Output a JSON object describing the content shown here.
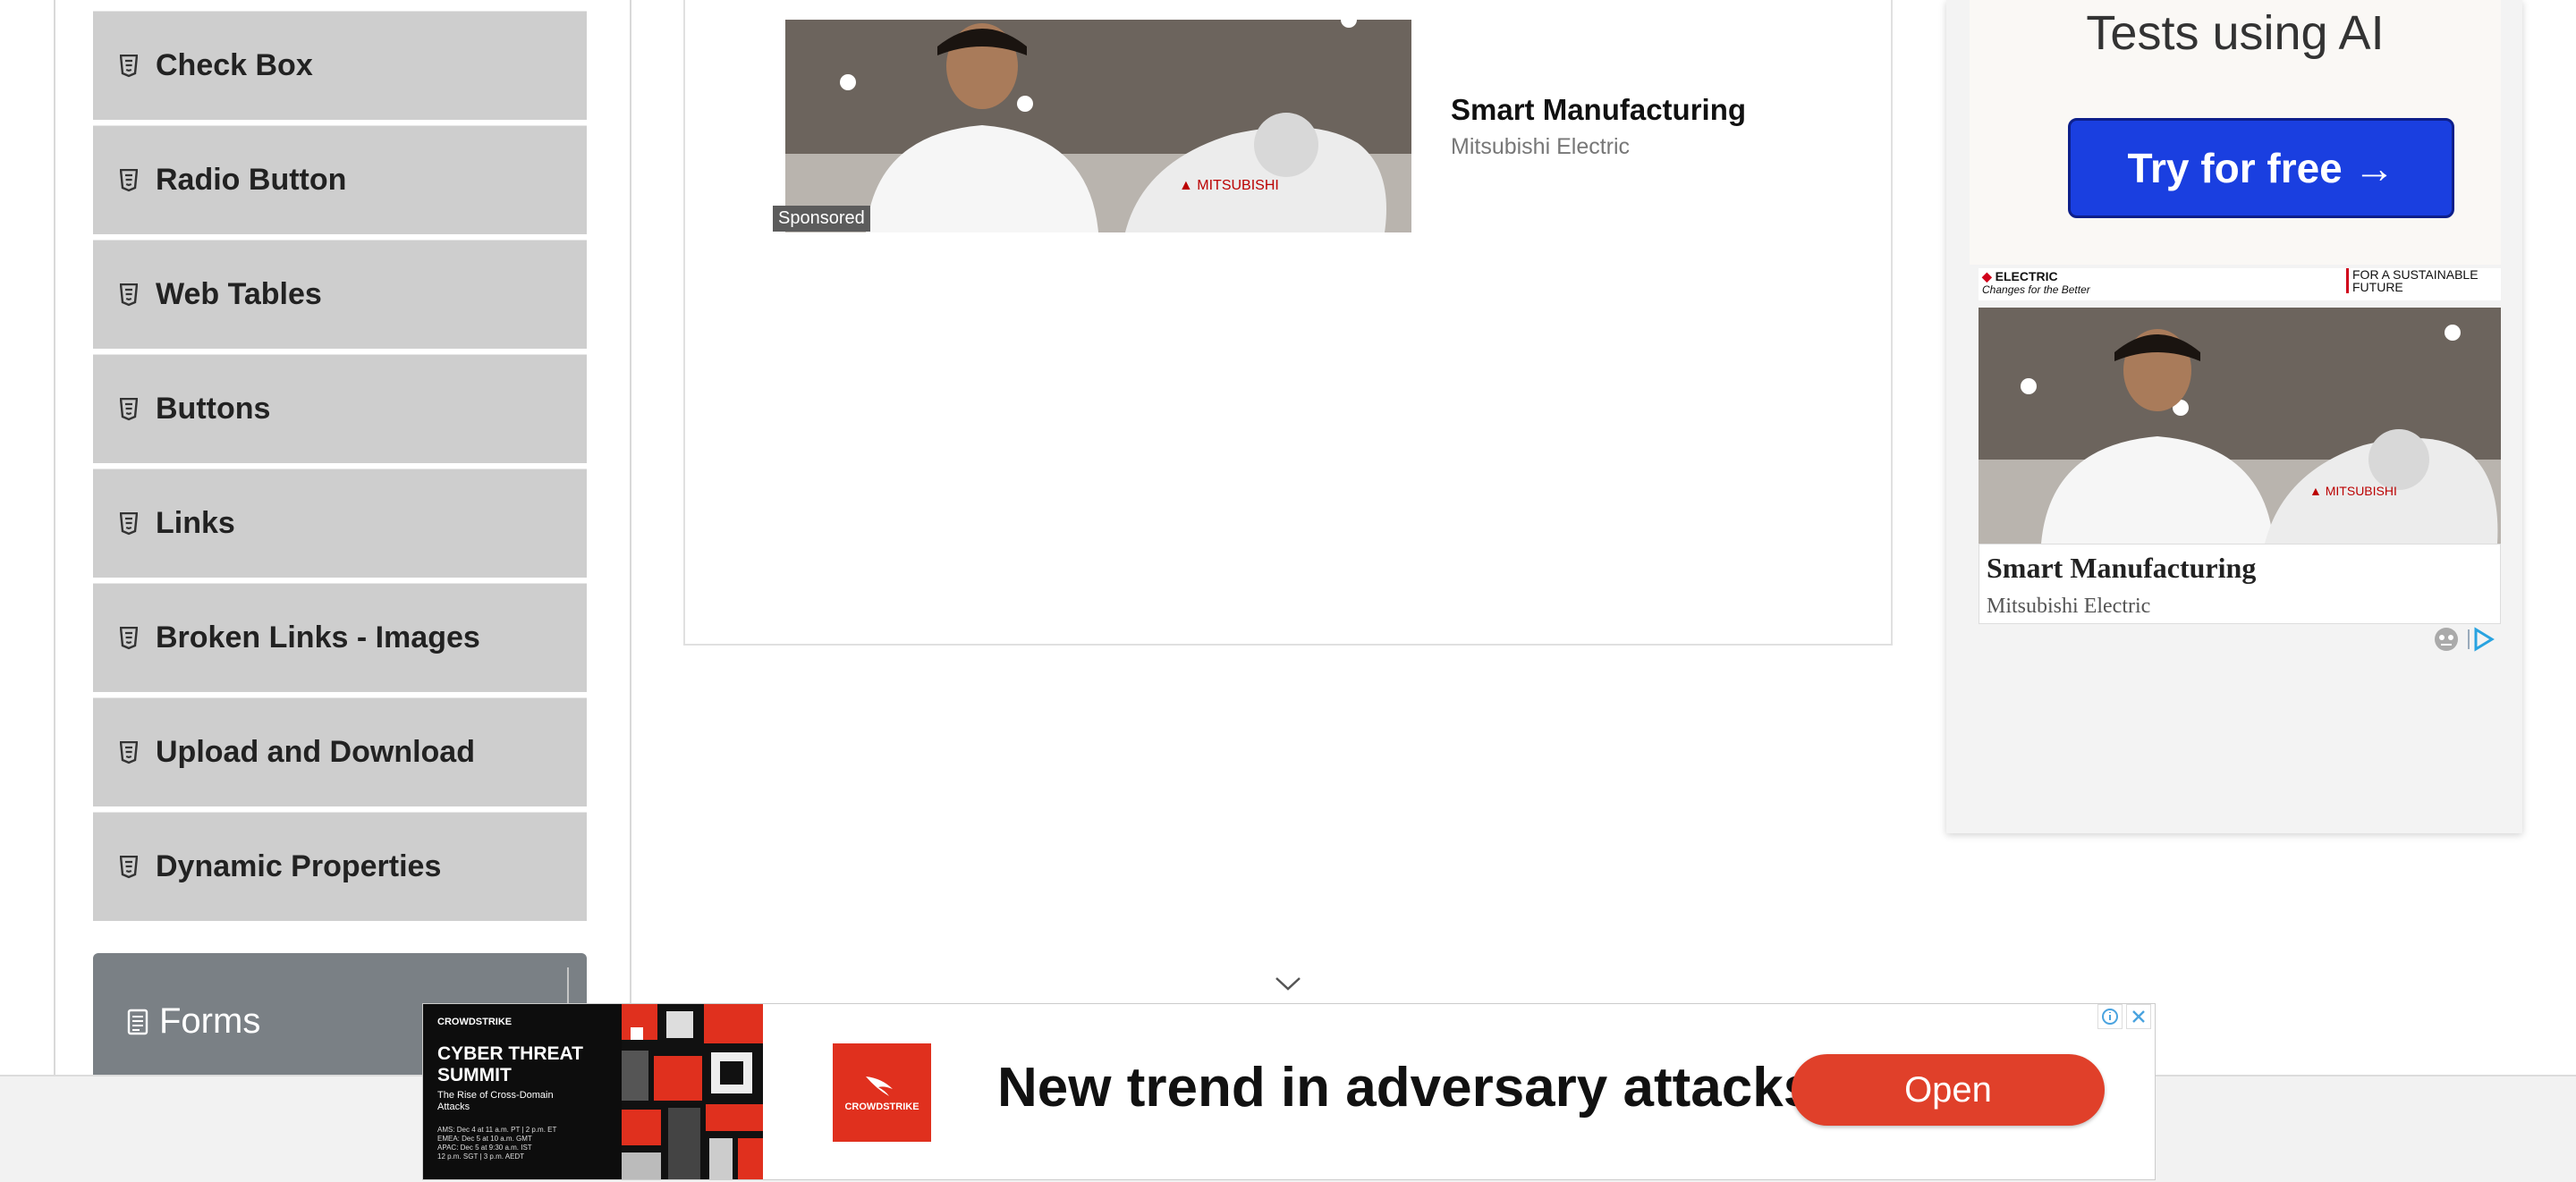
{
  "sidebar": {
    "items": [
      {
        "label": "Check Box"
      },
      {
        "label": "Radio Button"
      },
      {
        "label": "Web Tables"
      },
      {
        "label": "Buttons"
      },
      {
        "label": "Links"
      },
      {
        "label": "Broken Links - Images"
      },
      {
        "label": "Upload and Download"
      },
      {
        "label": "Dynamic Properties"
      }
    ],
    "forms_label": "Forms"
  },
  "center_ad": {
    "sponsored_label": "Sponsored",
    "title": "Smart Manufacturing",
    "advertiser": "Mitsubishi Electric"
  },
  "right_ad": {
    "headline_partial": "Tests using AI",
    "cta_label": "Try for free →",
    "brand_left": "ELECTRIC",
    "brand_left_tagline": "Changes for the Better",
    "brand_right": "FOR A SUSTAINABLE FUTURE",
    "title": "Smart Manufacturing",
    "advertiser": "Mitsubishi Electric"
  },
  "bottom_ad": {
    "brand": "CROWDSTRIKE",
    "event_title": "CYBER THREAT SUMMIT",
    "event_subtitle": "The Rise of Cross-Domain Attacks",
    "dates": [
      "AMS: Dec 4 at 11 a.m. PT | 2 p.m. ET",
      "EMEA: Dec 5 at 10 a.m. GMT",
      "APAC: Dec 5 at 9:30 a.m. IST",
      "12 p.m. SGT | 3 p.m. AEDT"
    ],
    "logo_text": "CROWDSTRIKE",
    "headline": "New trend in adversary attacks",
    "cta_label": "Open"
  },
  "colors": {
    "menu_bg": "#cecece",
    "forms_bg": "#7a8085",
    "cta_blue": "#1a3fe0",
    "open_red": "#e0402a",
    "crowdstrike_red": "#e0301e"
  }
}
